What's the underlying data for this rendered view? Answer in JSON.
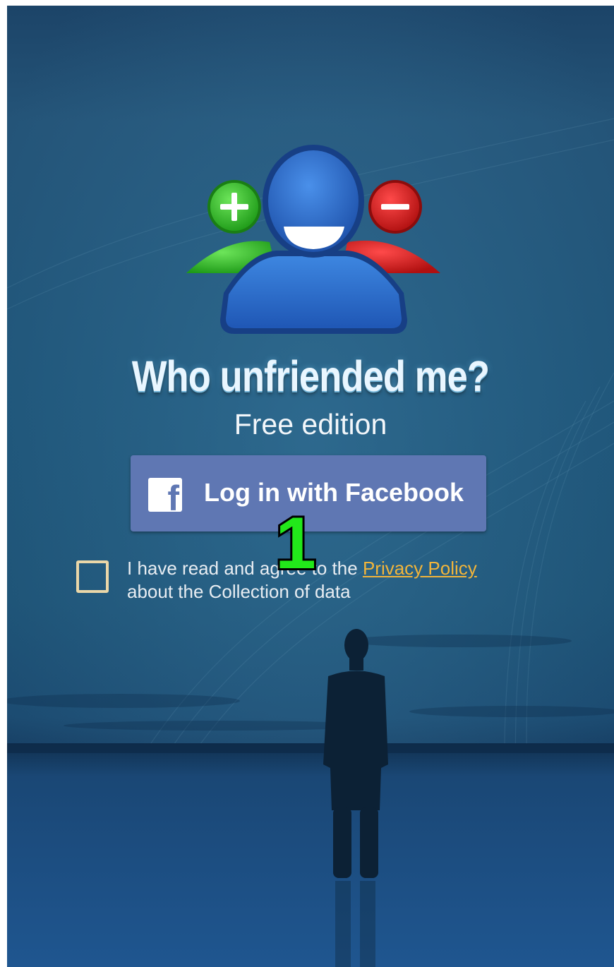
{
  "app": {
    "title": "Who unfriended me?",
    "subtitle": "Free edition"
  },
  "login": {
    "button_label": "Log in with Facebook",
    "icon_glyph": "f",
    "icon": "facebook-icon"
  },
  "consent": {
    "text_before_link": "I have read and agree to the",
    "link_label": "Privacy Policy",
    "text_after_link": "about the Collection of data",
    "checked": false
  },
  "annotation": {
    "step_number": "1"
  },
  "colors": {
    "facebook_button": "#5f77b3",
    "link": "#f2b53a",
    "add_badge": "#2fb82a",
    "remove_badge": "#cc1e1e",
    "user_blue": "#2b6fd0"
  }
}
